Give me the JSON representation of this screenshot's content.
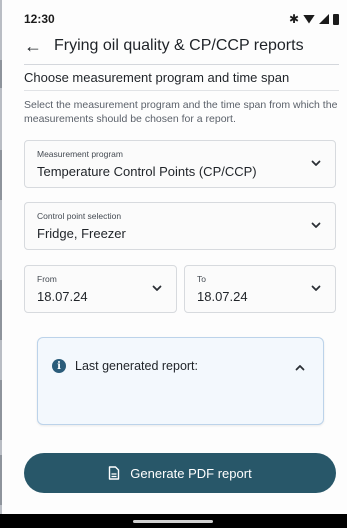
{
  "status": {
    "time": "12:30",
    "bluetooth": "✱"
  },
  "app_bar": {
    "title": "Frying oil quality & CP/CCP reports"
  },
  "section": {
    "title": "Choose measurement program and time span",
    "description": "Select the measurement program and the time span from which the measurements should be chosen for a report."
  },
  "program_field": {
    "label": "Measurement program",
    "value": "Temperature Control Points (CP/CCP)"
  },
  "control_field": {
    "label": "Control point selection",
    "value": "Fridge, Freezer"
  },
  "from_field": {
    "label": "From",
    "value": "18.07.24"
  },
  "to_field": {
    "label": "To",
    "value": "18.07.24"
  },
  "report_card": {
    "title": "Last generated report:"
  },
  "generate_button": {
    "label": "Generate PDF report"
  },
  "colors": {
    "primary": "#285769",
    "info": "#2a5c7a",
    "card_bg": "#f3f8fd",
    "card_border": "#bcd3ea"
  }
}
